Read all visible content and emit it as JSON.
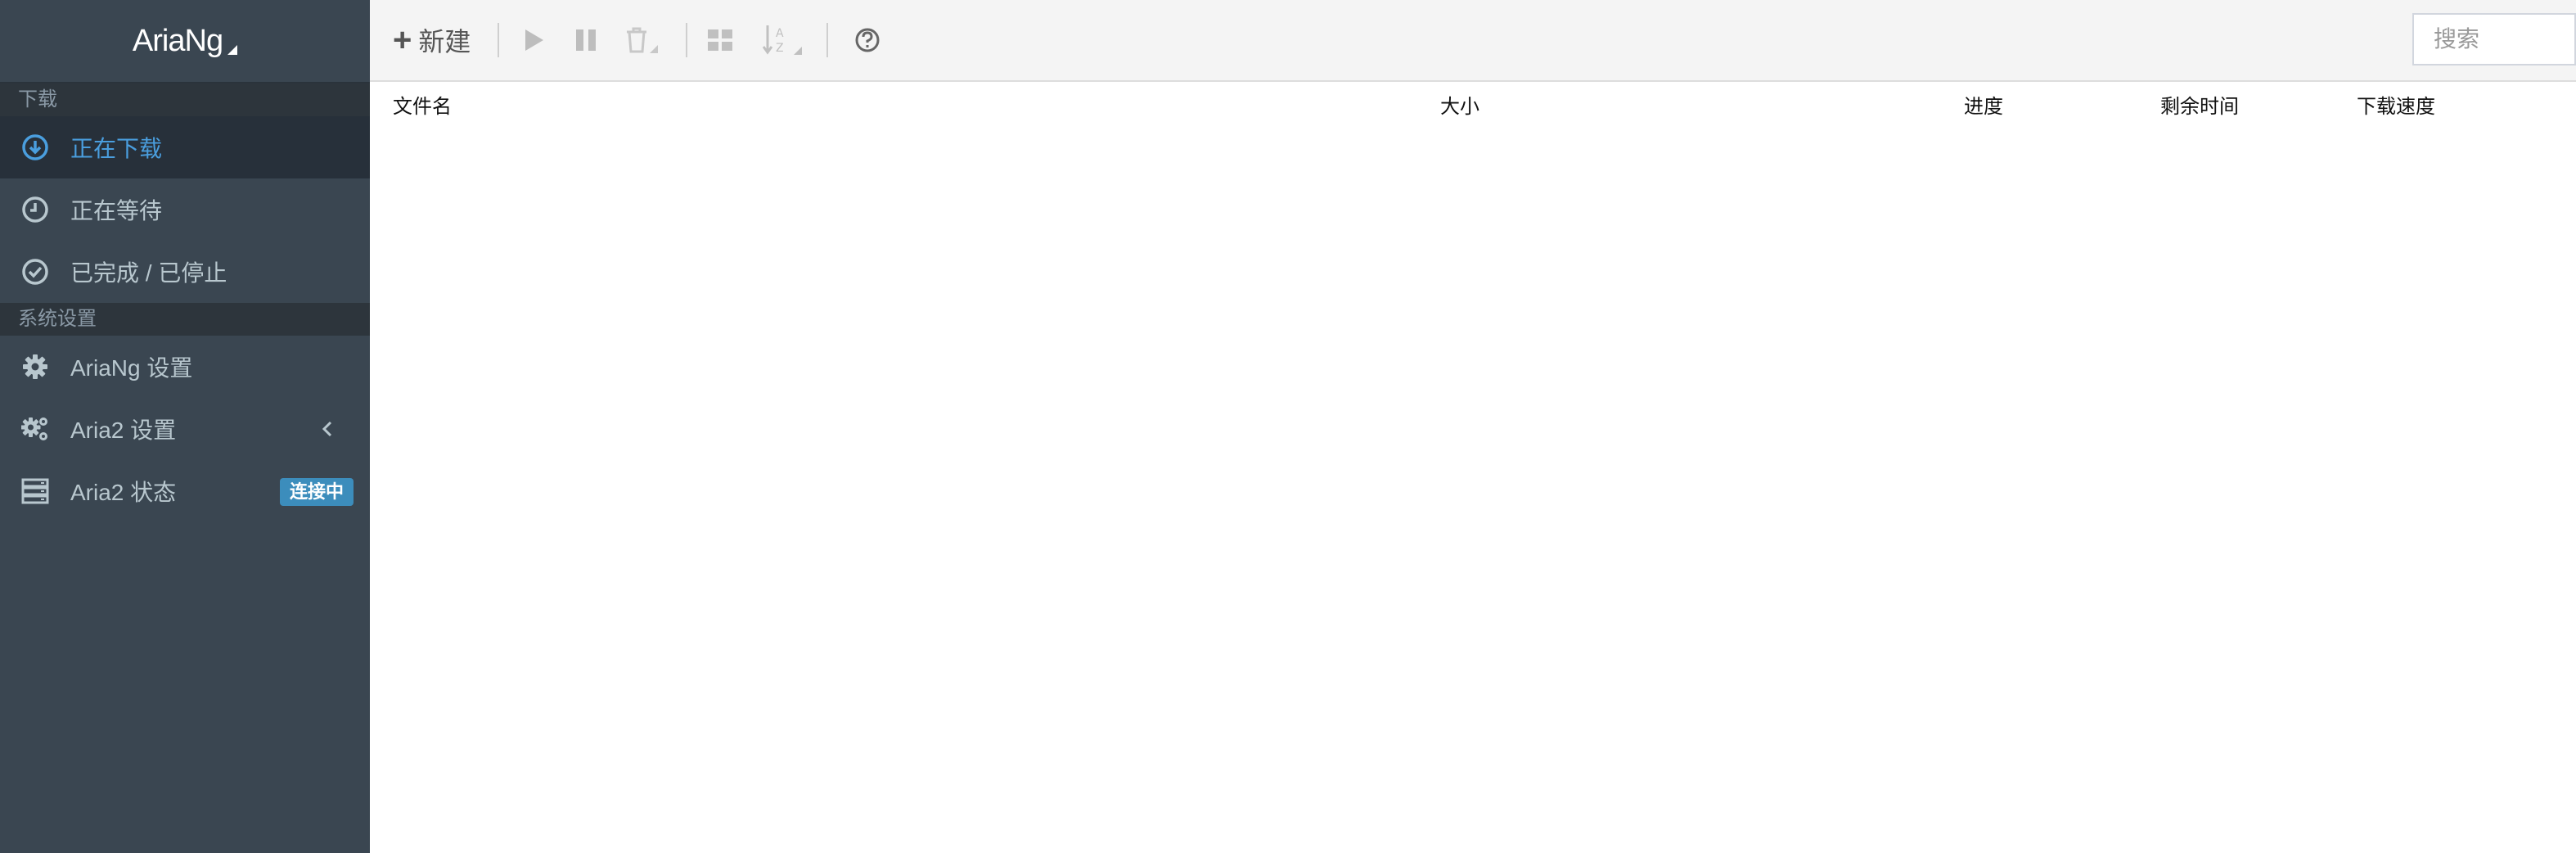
{
  "brand": {
    "title": "AriaNg"
  },
  "sidebar": {
    "sections": [
      {
        "title": "下载"
      },
      {
        "title": "系统设置"
      }
    ],
    "items": [
      {
        "label": "正在下载",
        "icon": "download-circle-icon"
      },
      {
        "label": "正在等待",
        "icon": "clock-icon"
      },
      {
        "label": "已完成 / 已停止",
        "icon": "check-circle-icon"
      },
      {
        "label": "AriaNg 设置",
        "icon": "gear-icon"
      },
      {
        "label": "Aria2 设置",
        "icon": "gears-icon"
      },
      {
        "label": "Aria2 状态",
        "icon": "server-icon",
        "badge": "连接中"
      }
    ]
  },
  "toolbar": {
    "new_label": "新建",
    "search_placeholder": "搜索"
  },
  "table": {
    "columns": [
      "文件名",
      "大小",
      "进度",
      "剩余时间",
      "下载速度"
    ]
  },
  "colors": {
    "sidebar_bg": "#3a4651",
    "active_item_bg": "#27303a",
    "accent": "#4a9ede",
    "badge_bg": "#3c8dbc"
  }
}
